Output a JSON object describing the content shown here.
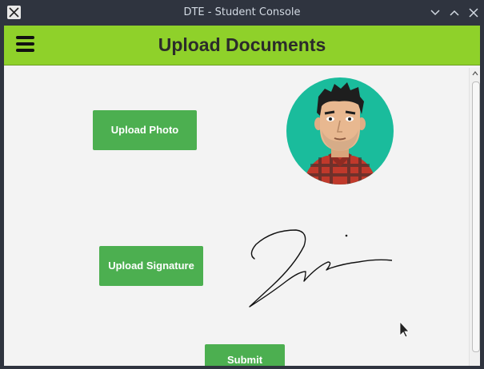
{
  "window": {
    "title": "DTE - Student Console"
  },
  "header": {
    "title": "Upload Documents"
  },
  "upload_photo": {
    "label": "Upload Photo"
  },
  "upload_signature": {
    "label": "Upload Signature"
  },
  "submit": {
    "label": "Submit"
  },
  "colors": {
    "header_bg": "#8fd12a",
    "button_bg": "#4caf50",
    "avatar_bg": "#1abc9c",
    "titlebar_bg": "#2f343f"
  },
  "icons": [
    "app-icon",
    "minimize-icon",
    "maximize-icon",
    "close-icon",
    "hamburger-menu-icon",
    "scroll-up-icon",
    "mouse-cursor-icon"
  ]
}
